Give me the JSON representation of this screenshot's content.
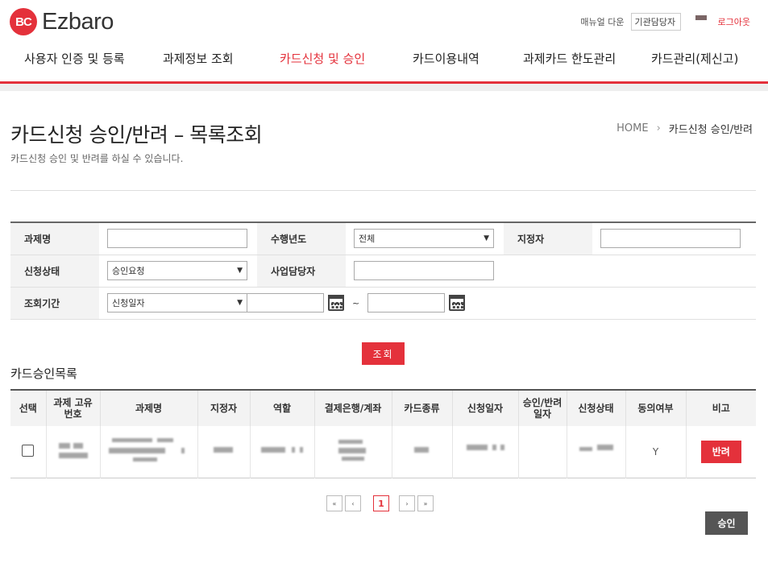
{
  "header": {
    "logo_mark": "BC",
    "logo_text": "Ezbaro",
    "manual_download": "매뉴얼 다운",
    "user_box": "기관담당자",
    "logout": "로그아웃",
    "accent": "#e4313b"
  },
  "nav": {
    "items": [
      {
        "label": "사용자 인증 및 등록"
      },
      {
        "label": "과제정보 조회"
      },
      {
        "label": "카드신청 및 승인",
        "active": true
      },
      {
        "label": "카드이용내역"
      },
      {
        "label": "과제카드 한도관리"
      },
      {
        "label": "카드관리(제신고)"
      }
    ]
  },
  "page": {
    "title": "카드신청 승인/반려 – 목록조회",
    "description": "카드신청 승인 및 반려를 하실 수 있습니다.",
    "breadcrumb": {
      "home": "HOME",
      "separator": "›",
      "current": "카드신청 승인/반려"
    }
  },
  "search": {
    "project_name_label": "과제명",
    "project_name_value": "",
    "year_label": "수행년도",
    "year_value": "전체",
    "designee_label": "지정자",
    "designee_value": "",
    "status_label": "신청상태",
    "status_value": "승인요청",
    "manager_label": "사업담당자",
    "manager_value": "",
    "period_label": "조회기간",
    "period_type_value": "신청일자",
    "date_from": "",
    "date_to": "",
    "tilde": "~",
    "button": "조회"
  },
  "list": {
    "title": "카드승인목록",
    "columns": [
      "선택",
      "과제 고유 번호",
      "과제명",
      "지정자",
      "역할",
      "결제은행/계좌",
      "카드종류",
      "신청일자",
      "승인/반려 일자",
      "신청상태",
      "동의여부",
      "비고"
    ],
    "rows": [
      {
        "consent": "Y",
        "reject_label": "반려"
      }
    ]
  },
  "pager": {
    "first": "«",
    "prev": "‹",
    "current": "1",
    "next": "›",
    "last": "»"
  },
  "approve_button": "승인"
}
